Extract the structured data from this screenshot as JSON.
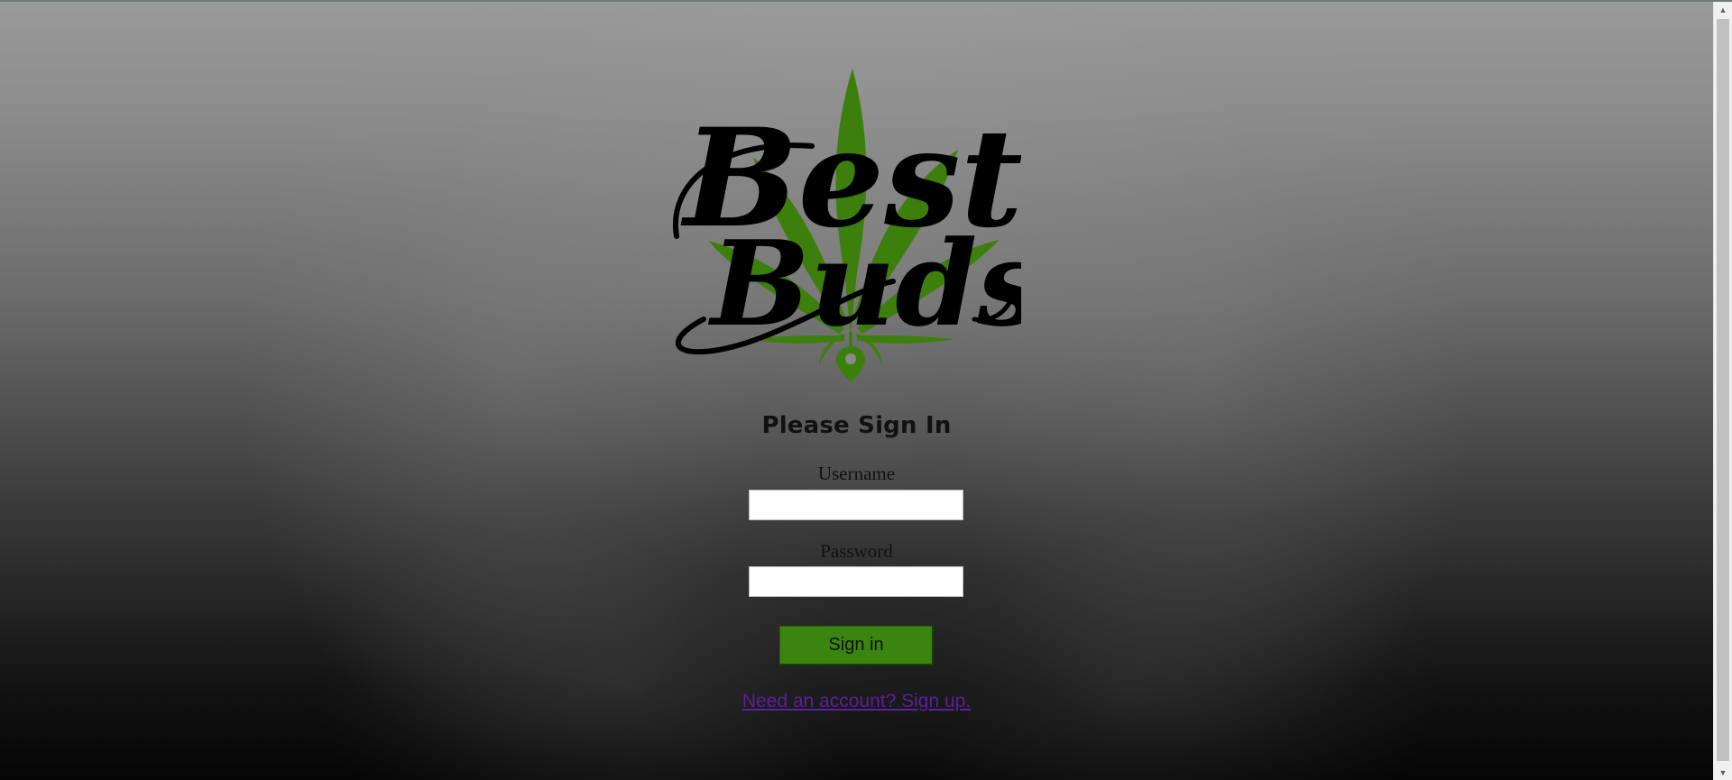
{
  "logo": {
    "script_line1": "Best",
    "script_line2": "Buds",
    "leaf_color": "#3d7f0c",
    "icon": "cannabis-leaf-icon"
  },
  "form": {
    "heading": "Please Sign In",
    "username_label": "Username",
    "username_value": "",
    "password_label": "Password",
    "password_value": "",
    "submit_label": "Sign in"
  },
  "links": {
    "signup": "Need an account? Sign up."
  },
  "colors": {
    "accent": "#3a8410",
    "link": "#5c1f9b"
  }
}
